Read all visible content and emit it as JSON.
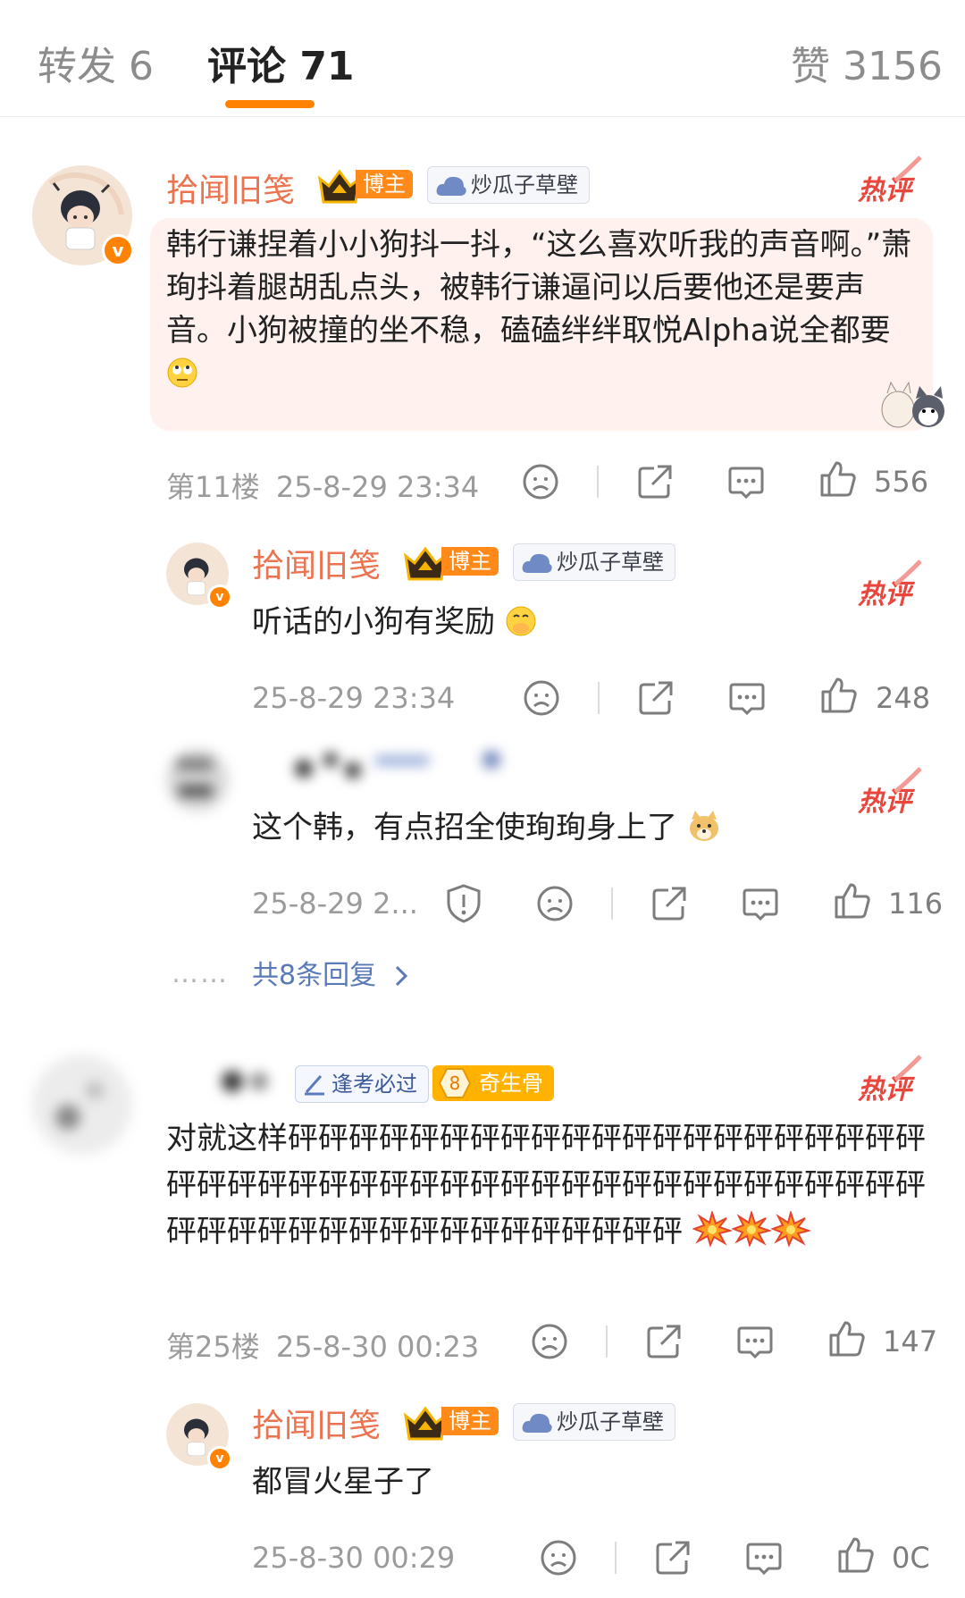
{
  "tabs": {
    "repost": "转发 6",
    "comments": "评论 71",
    "likes": "赞 3156"
  },
  "hot_label": "热评",
  "badges": {
    "boss": "博主",
    "group": "炒瓜子草壁",
    "kaoshi": "逢考必过",
    "level": "奇生骨",
    "level_num": "8"
  },
  "comments": [
    {
      "username": "拾闻旧笺",
      "text": "韩行谦捏着小小狗抖一抖，“这么喜欢听我的声音啊。”萧珣抖着腿胡乱点头，被韩行谦逼问以后要他还是要声音。小狗被撞的坐不稳，磕磕绊绊取悦Alpha说全都要",
      "floor": "第11楼",
      "time": "25-8-29 23:34",
      "likes": "556"
    },
    {
      "username": "拾闻旧笺",
      "text": "听话的小狗有奖励",
      "time": "25-8-29 23:34",
      "likes": "248"
    },
    {
      "text": "这个韩，有点招全使珣珣身上了",
      "time": "25-8-29 2...",
      "likes": "116",
      "replies": "共8条回复",
      "dots": "……"
    },
    {
      "text": "对就这样砰砰砰砰砰砰砰砰砰砰砰砰砰砰砰砰砰砰砰砰砰砰砰砰砰砰砰砰砰砰砰砰砰砰砰砰砰砰砰砰砰砰砰砰砰砰砰砰砰砰砰砰砰砰砰砰砰砰砰砰砰砰砰",
      "floor": "第25楼",
      "time": "25-8-30 00:23",
      "likes": "147"
    },
    {
      "username": "拾闻旧笺",
      "text": "都冒火星子了",
      "time": "25-8-30 00:29",
      "likes": "0C"
    }
  ],
  "colors": {
    "accent": "#ff8200",
    "username": "#eb7350",
    "hot": "#e8473d",
    "link": "#5a79b7"
  },
  "icons": [
    "sad-face-icon",
    "share-icon",
    "comment-icon",
    "like-icon",
    "report-icon",
    "chevron-right-icon",
    "crown-icon",
    "cloud-icon",
    "flame-icon"
  ]
}
